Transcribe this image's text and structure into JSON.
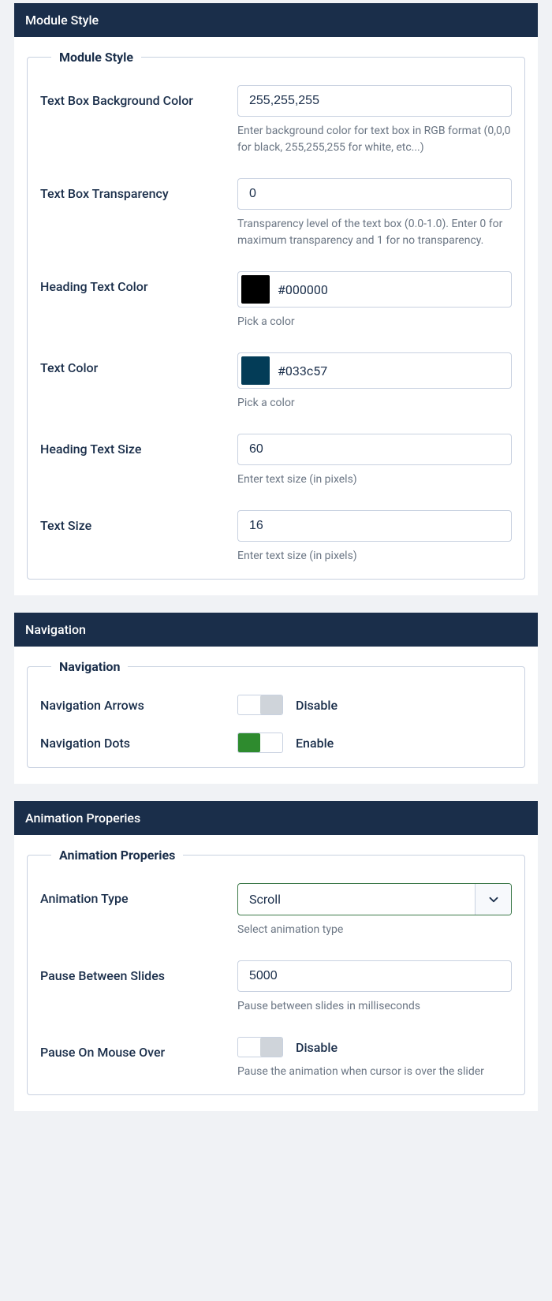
{
  "sections": {
    "moduleStyle": {
      "header": "Module Style",
      "legend": "Module Style",
      "fields": {
        "bgColor": {
          "label": "Text Box Background Color",
          "value": "255,255,255",
          "help": "Enter background color for text box in RGB format (0,0,0 for black, 255,255,255 for white, etc...)"
        },
        "transparency": {
          "label": "Text Box Transparency",
          "value": "0",
          "help": "Transparency level of the text box (0.0-1.0). Enter 0 for maximum transparency and 1 for no transparency."
        },
        "headingColor": {
          "label": "Heading Text Color",
          "value": "#000000",
          "swatch": "#000000",
          "help": "Pick a color"
        },
        "textColor": {
          "label": "Text Color",
          "value": "#033c57",
          "swatch": "#033c57",
          "help": "Pick a color"
        },
        "headingSize": {
          "label": "Heading Text Size",
          "value": "60",
          "help": "Enter text size (in pixels)"
        },
        "textSize": {
          "label": "Text Size",
          "value": "16",
          "help": "Enter text size (in pixels)"
        }
      }
    },
    "navigation": {
      "header": "Navigation",
      "legend": "Navigation",
      "fields": {
        "arrows": {
          "label": "Navigation Arrows",
          "state": "off",
          "stateLabel": "Disable"
        },
        "dots": {
          "label": "Navigation Dots",
          "state": "on",
          "stateLabel": "Enable"
        }
      }
    },
    "animation": {
      "header": "Animation Properies",
      "legend": "Animation Properies",
      "fields": {
        "type": {
          "label": "Animation Type",
          "value": "Scroll",
          "help": "Select animation type"
        },
        "pause": {
          "label": "Pause Between Slides",
          "value": "5000",
          "help": "Pause between slides in milliseconds"
        },
        "pauseHover": {
          "label": "Pause On Mouse Over",
          "state": "off",
          "stateLabel": "Disable",
          "help": "Pause the animation when cursor is over the slider"
        }
      }
    }
  }
}
